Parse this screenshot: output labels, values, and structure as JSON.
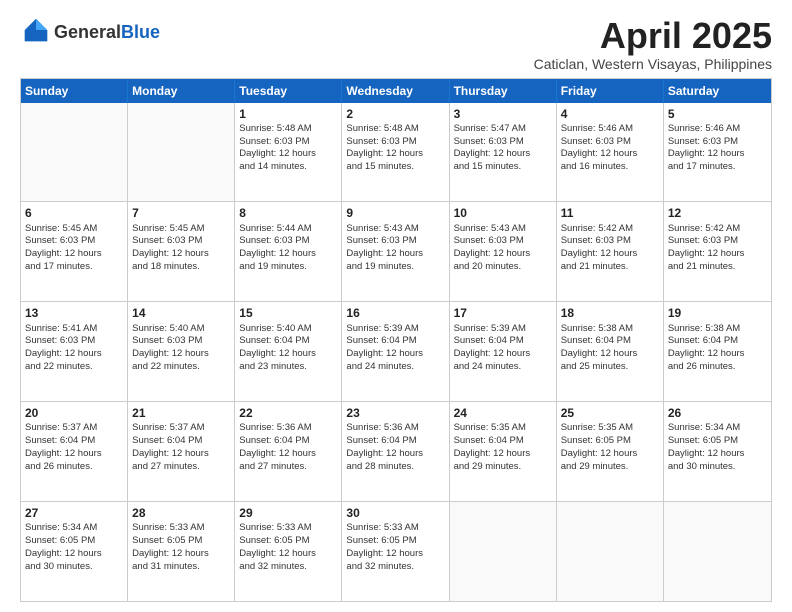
{
  "header": {
    "logo_general": "General",
    "logo_blue": "Blue",
    "month_title": "April 2025",
    "location": "Caticlan, Western Visayas, Philippines"
  },
  "days_of_week": [
    "Sunday",
    "Monday",
    "Tuesday",
    "Wednesday",
    "Thursday",
    "Friday",
    "Saturday"
  ],
  "weeks": [
    [
      {
        "day": "",
        "lines": []
      },
      {
        "day": "",
        "lines": []
      },
      {
        "day": "1",
        "lines": [
          "Sunrise: 5:48 AM",
          "Sunset: 6:03 PM",
          "Daylight: 12 hours",
          "and 14 minutes."
        ]
      },
      {
        "day": "2",
        "lines": [
          "Sunrise: 5:48 AM",
          "Sunset: 6:03 PM",
          "Daylight: 12 hours",
          "and 15 minutes."
        ]
      },
      {
        "day": "3",
        "lines": [
          "Sunrise: 5:47 AM",
          "Sunset: 6:03 PM",
          "Daylight: 12 hours",
          "and 15 minutes."
        ]
      },
      {
        "day": "4",
        "lines": [
          "Sunrise: 5:46 AM",
          "Sunset: 6:03 PM",
          "Daylight: 12 hours",
          "and 16 minutes."
        ]
      },
      {
        "day": "5",
        "lines": [
          "Sunrise: 5:46 AM",
          "Sunset: 6:03 PM",
          "Daylight: 12 hours",
          "and 17 minutes."
        ]
      }
    ],
    [
      {
        "day": "6",
        "lines": [
          "Sunrise: 5:45 AM",
          "Sunset: 6:03 PM",
          "Daylight: 12 hours",
          "and 17 minutes."
        ]
      },
      {
        "day": "7",
        "lines": [
          "Sunrise: 5:45 AM",
          "Sunset: 6:03 PM",
          "Daylight: 12 hours",
          "and 18 minutes."
        ]
      },
      {
        "day": "8",
        "lines": [
          "Sunrise: 5:44 AM",
          "Sunset: 6:03 PM",
          "Daylight: 12 hours",
          "and 19 minutes."
        ]
      },
      {
        "day": "9",
        "lines": [
          "Sunrise: 5:43 AM",
          "Sunset: 6:03 PM",
          "Daylight: 12 hours",
          "and 19 minutes."
        ]
      },
      {
        "day": "10",
        "lines": [
          "Sunrise: 5:43 AM",
          "Sunset: 6:03 PM",
          "Daylight: 12 hours",
          "and 20 minutes."
        ]
      },
      {
        "day": "11",
        "lines": [
          "Sunrise: 5:42 AM",
          "Sunset: 6:03 PM",
          "Daylight: 12 hours",
          "and 21 minutes."
        ]
      },
      {
        "day": "12",
        "lines": [
          "Sunrise: 5:42 AM",
          "Sunset: 6:03 PM",
          "Daylight: 12 hours",
          "and 21 minutes."
        ]
      }
    ],
    [
      {
        "day": "13",
        "lines": [
          "Sunrise: 5:41 AM",
          "Sunset: 6:03 PM",
          "Daylight: 12 hours",
          "and 22 minutes."
        ]
      },
      {
        "day": "14",
        "lines": [
          "Sunrise: 5:40 AM",
          "Sunset: 6:03 PM",
          "Daylight: 12 hours",
          "and 22 minutes."
        ]
      },
      {
        "day": "15",
        "lines": [
          "Sunrise: 5:40 AM",
          "Sunset: 6:04 PM",
          "Daylight: 12 hours",
          "and 23 minutes."
        ]
      },
      {
        "day": "16",
        "lines": [
          "Sunrise: 5:39 AM",
          "Sunset: 6:04 PM",
          "Daylight: 12 hours",
          "and 24 minutes."
        ]
      },
      {
        "day": "17",
        "lines": [
          "Sunrise: 5:39 AM",
          "Sunset: 6:04 PM",
          "Daylight: 12 hours",
          "and 24 minutes."
        ]
      },
      {
        "day": "18",
        "lines": [
          "Sunrise: 5:38 AM",
          "Sunset: 6:04 PM",
          "Daylight: 12 hours",
          "and 25 minutes."
        ]
      },
      {
        "day": "19",
        "lines": [
          "Sunrise: 5:38 AM",
          "Sunset: 6:04 PM",
          "Daylight: 12 hours",
          "and 26 minutes."
        ]
      }
    ],
    [
      {
        "day": "20",
        "lines": [
          "Sunrise: 5:37 AM",
          "Sunset: 6:04 PM",
          "Daylight: 12 hours",
          "and 26 minutes."
        ]
      },
      {
        "day": "21",
        "lines": [
          "Sunrise: 5:37 AM",
          "Sunset: 6:04 PM",
          "Daylight: 12 hours",
          "and 27 minutes."
        ]
      },
      {
        "day": "22",
        "lines": [
          "Sunrise: 5:36 AM",
          "Sunset: 6:04 PM",
          "Daylight: 12 hours",
          "and 27 minutes."
        ]
      },
      {
        "day": "23",
        "lines": [
          "Sunrise: 5:36 AM",
          "Sunset: 6:04 PM",
          "Daylight: 12 hours",
          "and 28 minutes."
        ]
      },
      {
        "day": "24",
        "lines": [
          "Sunrise: 5:35 AM",
          "Sunset: 6:04 PM",
          "Daylight: 12 hours",
          "and 29 minutes."
        ]
      },
      {
        "day": "25",
        "lines": [
          "Sunrise: 5:35 AM",
          "Sunset: 6:05 PM",
          "Daylight: 12 hours",
          "and 29 minutes."
        ]
      },
      {
        "day": "26",
        "lines": [
          "Sunrise: 5:34 AM",
          "Sunset: 6:05 PM",
          "Daylight: 12 hours",
          "and 30 minutes."
        ]
      }
    ],
    [
      {
        "day": "27",
        "lines": [
          "Sunrise: 5:34 AM",
          "Sunset: 6:05 PM",
          "Daylight: 12 hours",
          "and 30 minutes."
        ]
      },
      {
        "day": "28",
        "lines": [
          "Sunrise: 5:33 AM",
          "Sunset: 6:05 PM",
          "Daylight: 12 hours",
          "and 31 minutes."
        ]
      },
      {
        "day": "29",
        "lines": [
          "Sunrise: 5:33 AM",
          "Sunset: 6:05 PM",
          "Daylight: 12 hours",
          "and 32 minutes."
        ]
      },
      {
        "day": "30",
        "lines": [
          "Sunrise: 5:33 AM",
          "Sunset: 6:05 PM",
          "Daylight: 12 hours",
          "and 32 minutes."
        ]
      },
      {
        "day": "",
        "lines": []
      },
      {
        "day": "",
        "lines": []
      },
      {
        "day": "",
        "lines": []
      }
    ]
  ]
}
